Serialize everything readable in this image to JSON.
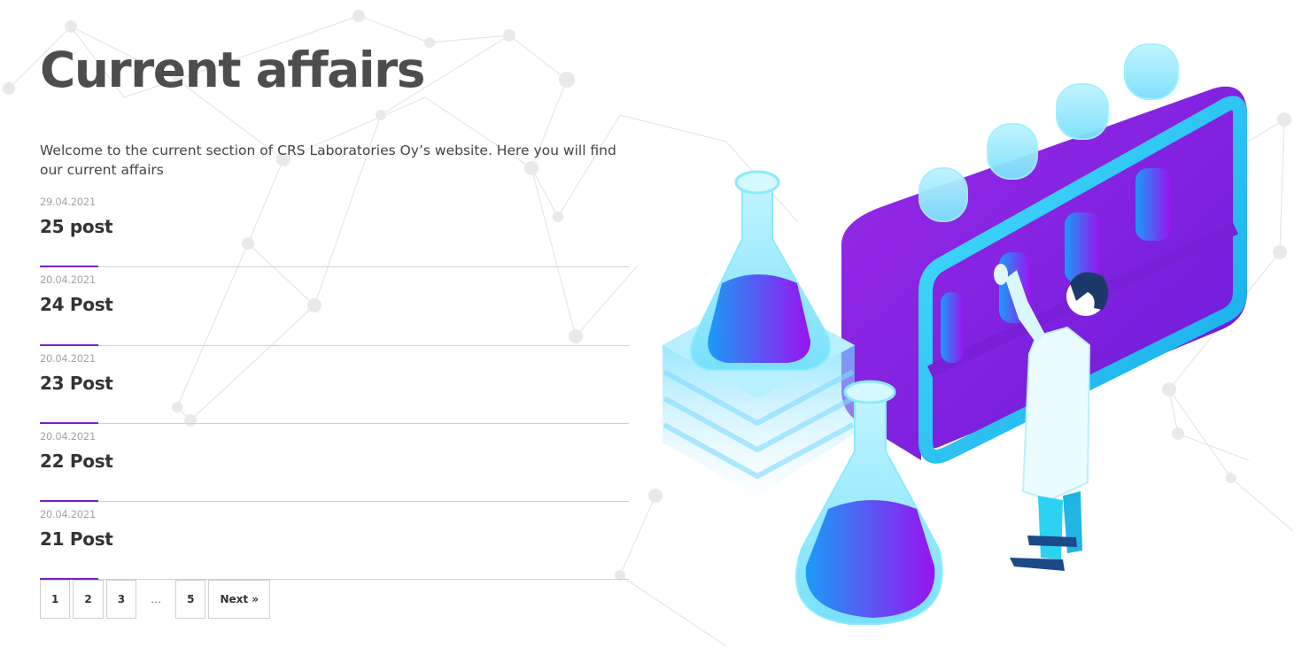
{
  "header": {
    "title": "Current affairs",
    "intro": "Welcome to the current section of CRS Laboratories Oy’s website. Here you will find our current affairs"
  },
  "posts": [
    {
      "date": "29.04.2021",
      "title": "25 post"
    },
    {
      "date": "20.04.2021",
      "title": "24 Post"
    },
    {
      "date": "20.04.2021",
      "title": "23 Post"
    },
    {
      "date": "20.04.2021",
      "title": "22 Post"
    },
    {
      "date": "20.04.2021",
      "title": "21 Post"
    }
  ],
  "pagination": {
    "pages": [
      "1",
      "2",
      "3",
      "…",
      "5"
    ],
    "next_label": "Next »"
  },
  "colors": {
    "accent": "#7a1fd0",
    "cyan": "#1fc8f0",
    "purple": "#8a22e8"
  },
  "illustration": {
    "icon": "laboratory-illustration"
  }
}
